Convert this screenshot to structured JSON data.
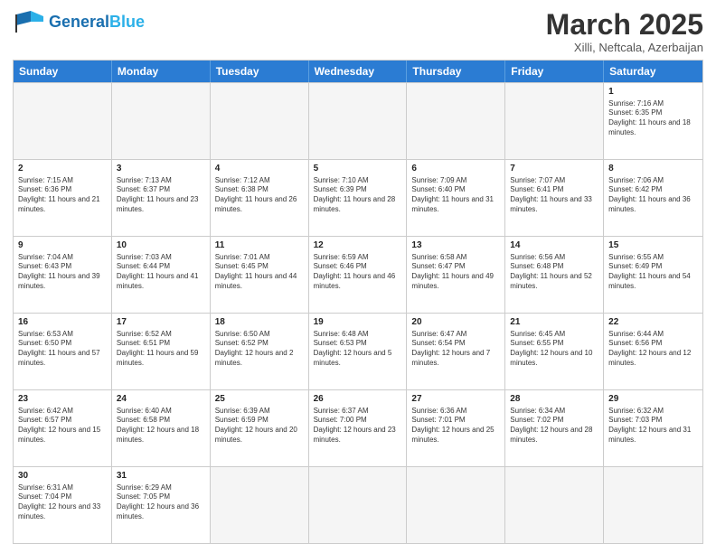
{
  "header": {
    "logo_general": "General",
    "logo_blue": "Blue",
    "month": "March 2025",
    "location": "Xilli, Neftcala, Azerbaijan"
  },
  "weekdays": [
    "Sunday",
    "Monday",
    "Tuesday",
    "Wednesday",
    "Thursday",
    "Friday",
    "Saturday"
  ],
  "weeks": [
    [
      {
        "day": "",
        "info": ""
      },
      {
        "day": "",
        "info": ""
      },
      {
        "day": "",
        "info": ""
      },
      {
        "day": "",
        "info": ""
      },
      {
        "day": "",
        "info": ""
      },
      {
        "day": "",
        "info": ""
      },
      {
        "day": "1",
        "info": "Sunrise: 7:16 AM\nSunset: 6:35 PM\nDaylight: 11 hours and 18 minutes."
      }
    ],
    [
      {
        "day": "2",
        "info": "Sunrise: 7:15 AM\nSunset: 6:36 PM\nDaylight: 11 hours and 21 minutes."
      },
      {
        "day": "3",
        "info": "Sunrise: 7:13 AM\nSunset: 6:37 PM\nDaylight: 11 hours and 23 minutes."
      },
      {
        "day": "4",
        "info": "Sunrise: 7:12 AM\nSunset: 6:38 PM\nDaylight: 11 hours and 26 minutes."
      },
      {
        "day": "5",
        "info": "Sunrise: 7:10 AM\nSunset: 6:39 PM\nDaylight: 11 hours and 28 minutes."
      },
      {
        "day": "6",
        "info": "Sunrise: 7:09 AM\nSunset: 6:40 PM\nDaylight: 11 hours and 31 minutes."
      },
      {
        "day": "7",
        "info": "Sunrise: 7:07 AM\nSunset: 6:41 PM\nDaylight: 11 hours and 33 minutes."
      },
      {
        "day": "8",
        "info": "Sunrise: 7:06 AM\nSunset: 6:42 PM\nDaylight: 11 hours and 36 minutes."
      }
    ],
    [
      {
        "day": "9",
        "info": "Sunrise: 7:04 AM\nSunset: 6:43 PM\nDaylight: 11 hours and 39 minutes."
      },
      {
        "day": "10",
        "info": "Sunrise: 7:03 AM\nSunset: 6:44 PM\nDaylight: 11 hours and 41 minutes."
      },
      {
        "day": "11",
        "info": "Sunrise: 7:01 AM\nSunset: 6:45 PM\nDaylight: 11 hours and 44 minutes."
      },
      {
        "day": "12",
        "info": "Sunrise: 6:59 AM\nSunset: 6:46 PM\nDaylight: 11 hours and 46 minutes."
      },
      {
        "day": "13",
        "info": "Sunrise: 6:58 AM\nSunset: 6:47 PM\nDaylight: 11 hours and 49 minutes."
      },
      {
        "day": "14",
        "info": "Sunrise: 6:56 AM\nSunset: 6:48 PM\nDaylight: 11 hours and 52 minutes."
      },
      {
        "day": "15",
        "info": "Sunrise: 6:55 AM\nSunset: 6:49 PM\nDaylight: 11 hours and 54 minutes."
      }
    ],
    [
      {
        "day": "16",
        "info": "Sunrise: 6:53 AM\nSunset: 6:50 PM\nDaylight: 11 hours and 57 minutes."
      },
      {
        "day": "17",
        "info": "Sunrise: 6:52 AM\nSunset: 6:51 PM\nDaylight: 11 hours and 59 minutes."
      },
      {
        "day": "18",
        "info": "Sunrise: 6:50 AM\nSunset: 6:52 PM\nDaylight: 12 hours and 2 minutes."
      },
      {
        "day": "19",
        "info": "Sunrise: 6:48 AM\nSunset: 6:53 PM\nDaylight: 12 hours and 5 minutes."
      },
      {
        "day": "20",
        "info": "Sunrise: 6:47 AM\nSunset: 6:54 PM\nDaylight: 12 hours and 7 minutes."
      },
      {
        "day": "21",
        "info": "Sunrise: 6:45 AM\nSunset: 6:55 PM\nDaylight: 12 hours and 10 minutes."
      },
      {
        "day": "22",
        "info": "Sunrise: 6:44 AM\nSunset: 6:56 PM\nDaylight: 12 hours and 12 minutes."
      }
    ],
    [
      {
        "day": "23",
        "info": "Sunrise: 6:42 AM\nSunset: 6:57 PM\nDaylight: 12 hours and 15 minutes."
      },
      {
        "day": "24",
        "info": "Sunrise: 6:40 AM\nSunset: 6:58 PM\nDaylight: 12 hours and 18 minutes."
      },
      {
        "day": "25",
        "info": "Sunrise: 6:39 AM\nSunset: 6:59 PM\nDaylight: 12 hours and 20 minutes."
      },
      {
        "day": "26",
        "info": "Sunrise: 6:37 AM\nSunset: 7:00 PM\nDaylight: 12 hours and 23 minutes."
      },
      {
        "day": "27",
        "info": "Sunrise: 6:36 AM\nSunset: 7:01 PM\nDaylight: 12 hours and 25 minutes."
      },
      {
        "day": "28",
        "info": "Sunrise: 6:34 AM\nSunset: 7:02 PM\nDaylight: 12 hours and 28 minutes."
      },
      {
        "day": "29",
        "info": "Sunrise: 6:32 AM\nSunset: 7:03 PM\nDaylight: 12 hours and 31 minutes."
      }
    ],
    [
      {
        "day": "30",
        "info": "Sunrise: 6:31 AM\nSunset: 7:04 PM\nDaylight: 12 hours and 33 minutes."
      },
      {
        "day": "31",
        "info": "Sunrise: 6:29 AM\nSunset: 7:05 PM\nDaylight: 12 hours and 36 minutes."
      },
      {
        "day": "",
        "info": ""
      },
      {
        "day": "",
        "info": ""
      },
      {
        "day": "",
        "info": ""
      },
      {
        "day": "",
        "info": ""
      },
      {
        "day": "",
        "info": ""
      }
    ]
  ]
}
